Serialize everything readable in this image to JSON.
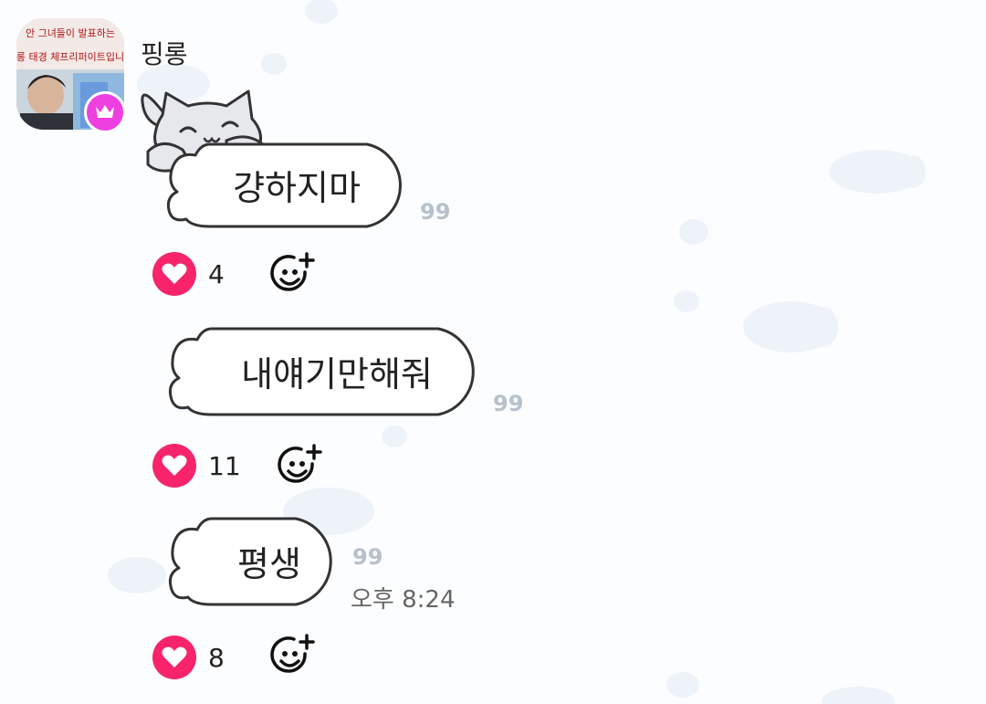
{
  "chat": {
    "sender": {
      "name": "핑롱",
      "avatar_lines": [
        "안 그녀들이 발표하는",
        "핑롱 태경 체프리퍼이트입니다"
      ]
    },
    "messages": [
      {
        "text": "걍하지마",
        "read_count": "99",
        "likes": "4"
      },
      {
        "text": "내얘기만해줘",
        "read_count": "99",
        "likes": "11"
      },
      {
        "text": "평생",
        "read_count": "99",
        "time": "오후 8:24",
        "likes": "8"
      }
    ]
  },
  "icons": {
    "crown": "crown-icon",
    "heart": "heart-icon",
    "add_reaction": "add-reaction-icon",
    "cat": "cat-sticker-icon"
  },
  "colors": {
    "heart": "#f7246b",
    "crown_badge": "#ee3fe0",
    "read_count": "#b7c1cb",
    "bubble_border": "#333333"
  }
}
